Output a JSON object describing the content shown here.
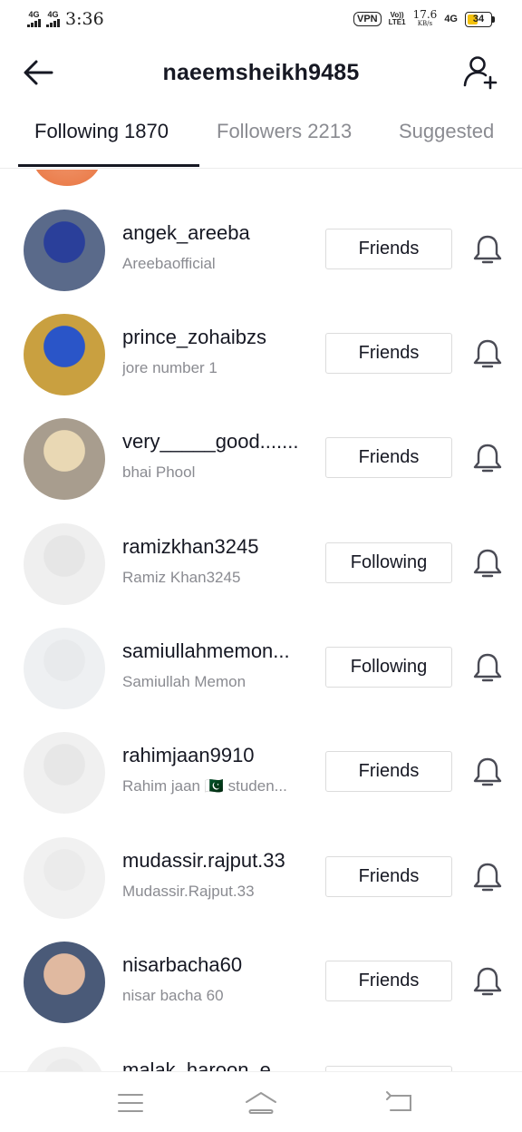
{
  "status_bar": {
    "network_1": "4G",
    "network_2": "4G",
    "time": "3:36",
    "vpn": "VPN",
    "volte_top": "Vo))",
    "volte_bottom": "LTE1",
    "speed_value": "17.6",
    "speed_unit": "KB/s",
    "network_3": "4G",
    "battery_level": "34"
  },
  "header": {
    "title": "naeemsheikh9485"
  },
  "tabs": [
    {
      "label": "Following 1870",
      "active": true
    },
    {
      "label": "Followers 2213",
      "active": false
    },
    {
      "label": "Suggested",
      "active": false
    }
  ],
  "users": [
    {
      "username": "angek_areeba",
      "nickname": "Areebaofficial",
      "button": "Friends",
      "avatar_bg": "#5a6a8a",
      "avatar_accent": "#2a3f9a"
    },
    {
      "username": "prince_zohaibzs",
      "nickname": "jore number 1",
      "button": "Friends",
      "avatar_bg": "#c9a040",
      "avatar_accent": "#2a55c8"
    },
    {
      "username": "very_____good.......",
      "nickname": "bhai Phool",
      "button": "Friends",
      "avatar_bg": "#a89d8e",
      "avatar_accent": "#e9d8b4"
    },
    {
      "username": "ramizkhan3245",
      "nickname": "Ramiz Khan3245",
      "button": "Following",
      "avatar_bg": "#efefef",
      "avatar_accent": "#e6e6e6"
    },
    {
      "username": "samiullahmemon...",
      "nickname": "Samiullah Memon",
      "button": "Following",
      "avatar_bg": "#eef0f2",
      "avatar_accent": "#e8eaec"
    },
    {
      "username": "rahimjaan9910",
      "nickname": "Rahim jaan 🇵🇰 studen...",
      "button": "Friends",
      "avatar_bg": "#f0f0f0",
      "avatar_accent": "#e7e7e7"
    },
    {
      "username": "mudassir.rajput.33",
      "nickname": "Mudassir.Rajput.33",
      "button": "Friends",
      "avatar_bg": "#f1f1f1",
      "avatar_accent": "#ebebeb"
    },
    {
      "username": "nisarbacha60",
      "nickname": "nisar bacha 60",
      "button": "Friends",
      "avatar_bg": "#4a5a78",
      "avatar_accent": "#e0b9a0"
    },
    {
      "username": "malak_haroon_e",
      "nickname": "",
      "button": "",
      "avatar_bg": "#f1f1f1",
      "avatar_accent": "#ebebeb"
    }
  ],
  "icons": {
    "back": "back-arrow-icon",
    "add_user": "add-user-icon",
    "bell": "bell-icon",
    "menu": "menu-icon",
    "home": "home-icon",
    "return": "return-icon"
  }
}
